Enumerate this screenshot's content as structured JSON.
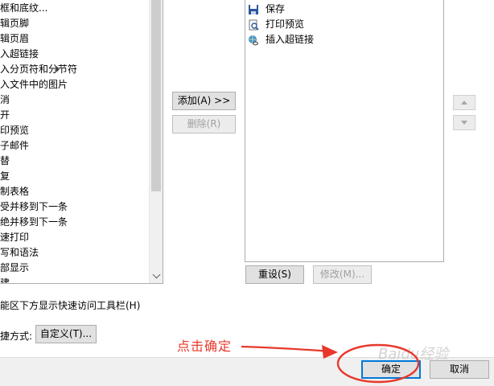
{
  "commands": [
    {
      "label": "框和底纹...",
      "has_submenu": false
    },
    {
      "label": "辑页脚",
      "has_submenu": false
    },
    {
      "label": "辑页眉",
      "has_submenu": false
    },
    {
      "label": "入超链接",
      "has_submenu": false
    },
    {
      "label": "入分页符和分节符",
      "has_submenu": true
    },
    {
      "label": "入文件中的图片",
      "has_submenu": false
    },
    {
      "label": "消",
      "has_submenu": true
    },
    {
      "label": "开",
      "has_submenu": false
    },
    {
      "label": "印预览",
      "has_submenu": false
    },
    {
      "label": "子邮件",
      "has_submenu": false
    },
    {
      "label": "替",
      "has_submenu": false
    },
    {
      "label": "复",
      "has_submenu": false
    },
    {
      "label": "制表格",
      "has_submenu": false
    },
    {
      "label": "受并移到下一条",
      "has_submenu": false
    },
    {
      "label": "绝并移到下一条",
      "has_submenu": false
    },
    {
      "label": "速打印",
      "has_submenu": false
    },
    {
      "label": "写和语法",
      "has_submenu": false
    },
    {
      "label": "部显示",
      "has_submenu": false
    },
    {
      "label": "建",
      "has_submenu": false
    }
  ],
  "buttons": {
    "add": "添加(A) >>",
    "remove": "删除(R)",
    "reset": "重设(S)",
    "modify": "修改(M)...",
    "customize": "自定义(T)...",
    "ok": "确定",
    "cancel": "取消"
  },
  "toolbar_items": [
    {
      "label": "保存",
      "icon": "save-icon"
    },
    {
      "label": "打印预览",
      "icon": "print-preview-icon"
    },
    {
      "label": "插入超链接",
      "icon": "hyperlink-icon"
    }
  ],
  "labels": {
    "show_below_ribbon": "能区下方显示快速访问工具栏(H)",
    "shortcuts": "捷方式:"
  },
  "annotation": "点击确定",
  "watermark": "Baidu经验",
  "colors": {
    "annotation_red": "#e8382b",
    "focus_blue": "#0078d7"
  }
}
